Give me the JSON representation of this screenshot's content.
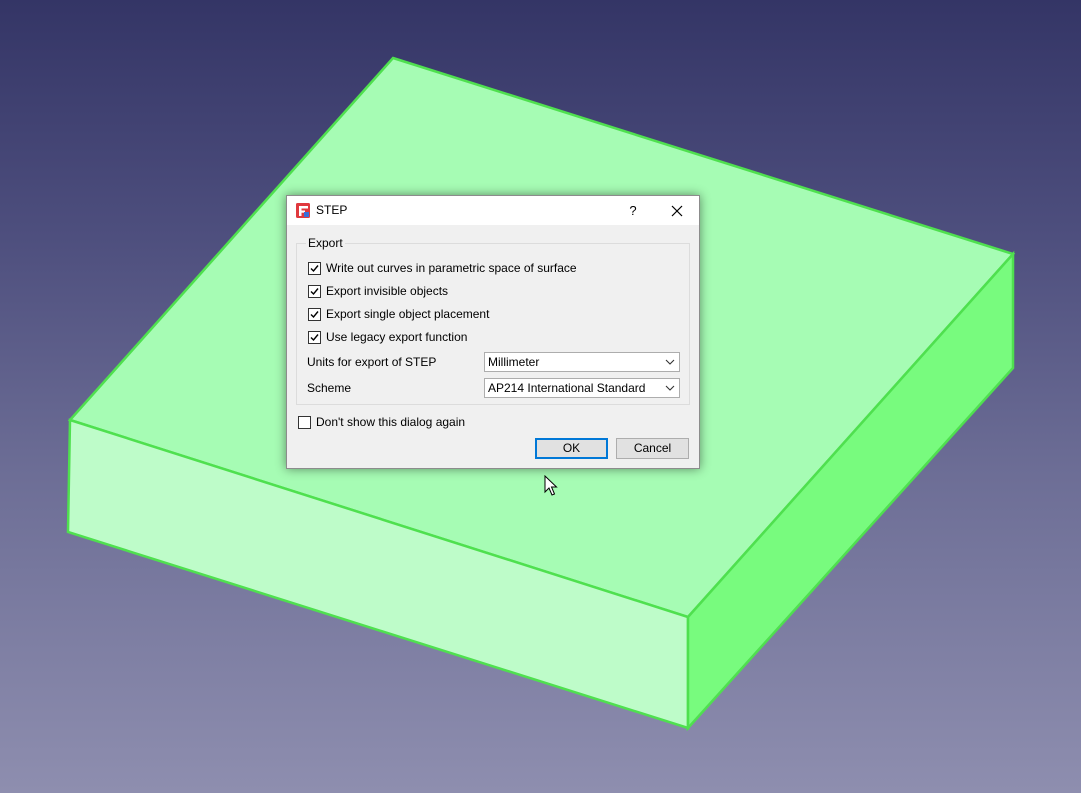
{
  "dialog": {
    "title": "STEP",
    "help_symbol": "?",
    "group_title": "Export",
    "options": [
      {
        "label": "Write out curves in parametric space of surface",
        "checked": true
      },
      {
        "label": "Export invisible objects",
        "checked": true
      },
      {
        "label": "Export single object placement",
        "checked": true
      },
      {
        "label": "Use legacy export function",
        "checked": true
      }
    ],
    "units_label": "Units for export of STEP",
    "units_value": "Millimeter",
    "scheme_label": "Scheme",
    "scheme_value": "AP214 International Standard",
    "dont_show_label": "Don't show this dialog again",
    "dont_show_checked": false,
    "ok_label": "OK",
    "cancel_label": "Cancel"
  },
  "viewport": {
    "object_color": "#a6fcb4",
    "edge_color": "#4fe04f",
    "background_top": "#343566",
    "background_bottom": "#8e8eaf"
  },
  "colors": {
    "accent": "#0078d7",
    "dialog_bg": "#f0f0f0",
    "app_icon_red": "#e0393e",
    "app_icon_blue": "#3a6fd8"
  }
}
